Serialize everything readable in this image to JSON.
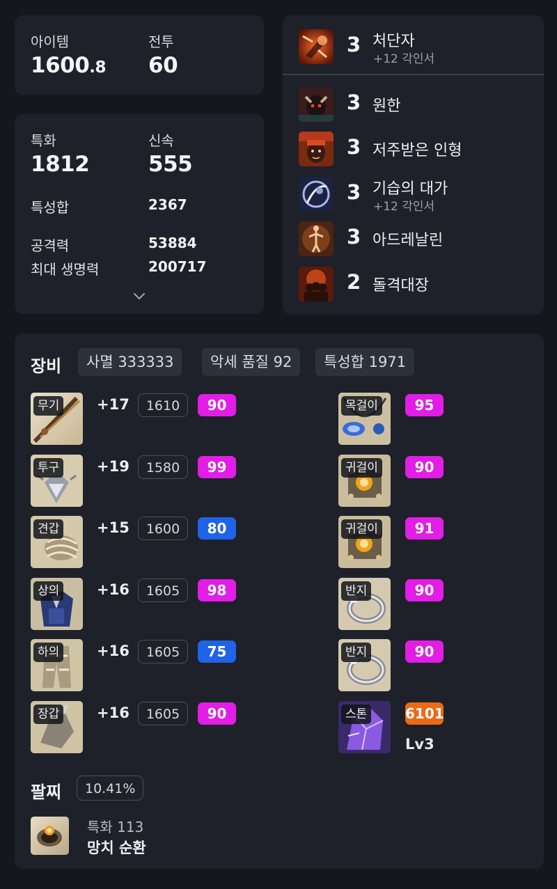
{
  "summary": {
    "item_label": "아이템",
    "item_value_main": "1600",
    "item_value_decimal": ".8",
    "combat_label": "전투",
    "combat_value": "60"
  },
  "stats": {
    "crit_label": "특화",
    "crit_value": "1812",
    "swift_label": "신속",
    "swift_value": "555",
    "total_label": "특성합",
    "total_value": "2367",
    "atk_label": "공격력",
    "atk_value": "53884",
    "hp_label": "최대 생명력",
    "hp_value": "200717",
    "expand_icon": "chevron-down-icon"
  },
  "engravings": [
    {
      "level": "3",
      "name": "처단자",
      "sub": "+12 각인서",
      "icon": "executioner-engraving-icon"
    },
    {
      "level": "3",
      "name": "원한",
      "sub": "",
      "icon": "grudge-engraving-icon"
    },
    {
      "level": "3",
      "name": "저주받은 인형",
      "sub": "",
      "icon": "cursed-doll-engraving-icon"
    },
    {
      "level": "3",
      "name": "기습의 대가",
      "sub": "+12 각인서",
      "icon": "master-ambusher-engraving-icon"
    },
    {
      "level": "3",
      "name": "아드레날린",
      "sub": "",
      "icon": "adrenaline-engraving-icon"
    },
    {
      "level": "2",
      "name": "돌격대장",
      "sub": "",
      "icon": "raid-captain-engraving-icon"
    }
  ],
  "equipment": {
    "title": "장비",
    "chips": [
      "사멸 333333",
      "악세 품질 92",
      "특성합 1971"
    ],
    "armor": [
      {
        "slot": "무기",
        "honing": "+17",
        "ilvl": "1610",
        "quality": "90",
        "qcolor": "magenta",
        "icon": "weapon-icon"
      },
      {
        "slot": "투구",
        "honing": "+19",
        "ilvl": "1580",
        "quality": "99",
        "qcolor": "magenta",
        "icon": "helmet-icon"
      },
      {
        "slot": "견갑",
        "honing": "+15",
        "ilvl": "1600",
        "quality": "80",
        "qcolor": "blue",
        "icon": "shoulder-icon"
      },
      {
        "slot": "상의",
        "honing": "+16",
        "ilvl": "1605",
        "quality": "98",
        "qcolor": "magenta",
        "icon": "chest-icon"
      },
      {
        "slot": "하의",
        "honing": "+16",
        "ilvl": "1605",
        "quality": "75",
        "qcolor": "blue",
        "icon": "pants-icon"
      },
      {
        "slot": "장갑",
        "honing": "+16",
        "ilvl": "1605",
        "quality": "90",
        "qcolor": "magenta",
        "icon": "gloves-icon"
      }
    ],
    "accessories": [
      {
        "slot": "목걸이",
        "quality": "95",
        "qcolor": "magenta",
        "icon": "necklace-icon"
      },
      {
        "slot": "귀걸이",
        "quality": "90",
        "qcolor": "magenta",
        "icon": "earring-icon"
      },
      {
        "slot": "귀걸이",
        "quality": "91",
        "qcolor": "magenta",
        "icon": "earring-icon"
      },
      {
        "slot": "반지",
        "quality": "90",
        "qcolor": "magenta",
        "icon": "ring-icon"
      },
      {
        "slot": "반지",
        "quality": "90",
        "qcolor": "magenta",
        "icon": "ring-icon"
      },
      {
        "slot": "스톤",
        "quality": "6101",
        "qcolor": "orange",
        "level": "Lv3",
        "icon": "ability-stone-icon"
      }
    ]
  },
  "bracelet": {
    "title": "팔찌",
    "percent": "10.41%",
    "stat": "특화 113",
    "effects": "망치  순환",
    "icon": "bracelet-icon"
  },
  "colors": {
    "background": "#15171c",
    "card": "#1e2129",
    "quality_magenta": "#e11de6",
    "quality_blue": "#1f63e6",
    "quality_orange": "#ec6a16"
  }
}
